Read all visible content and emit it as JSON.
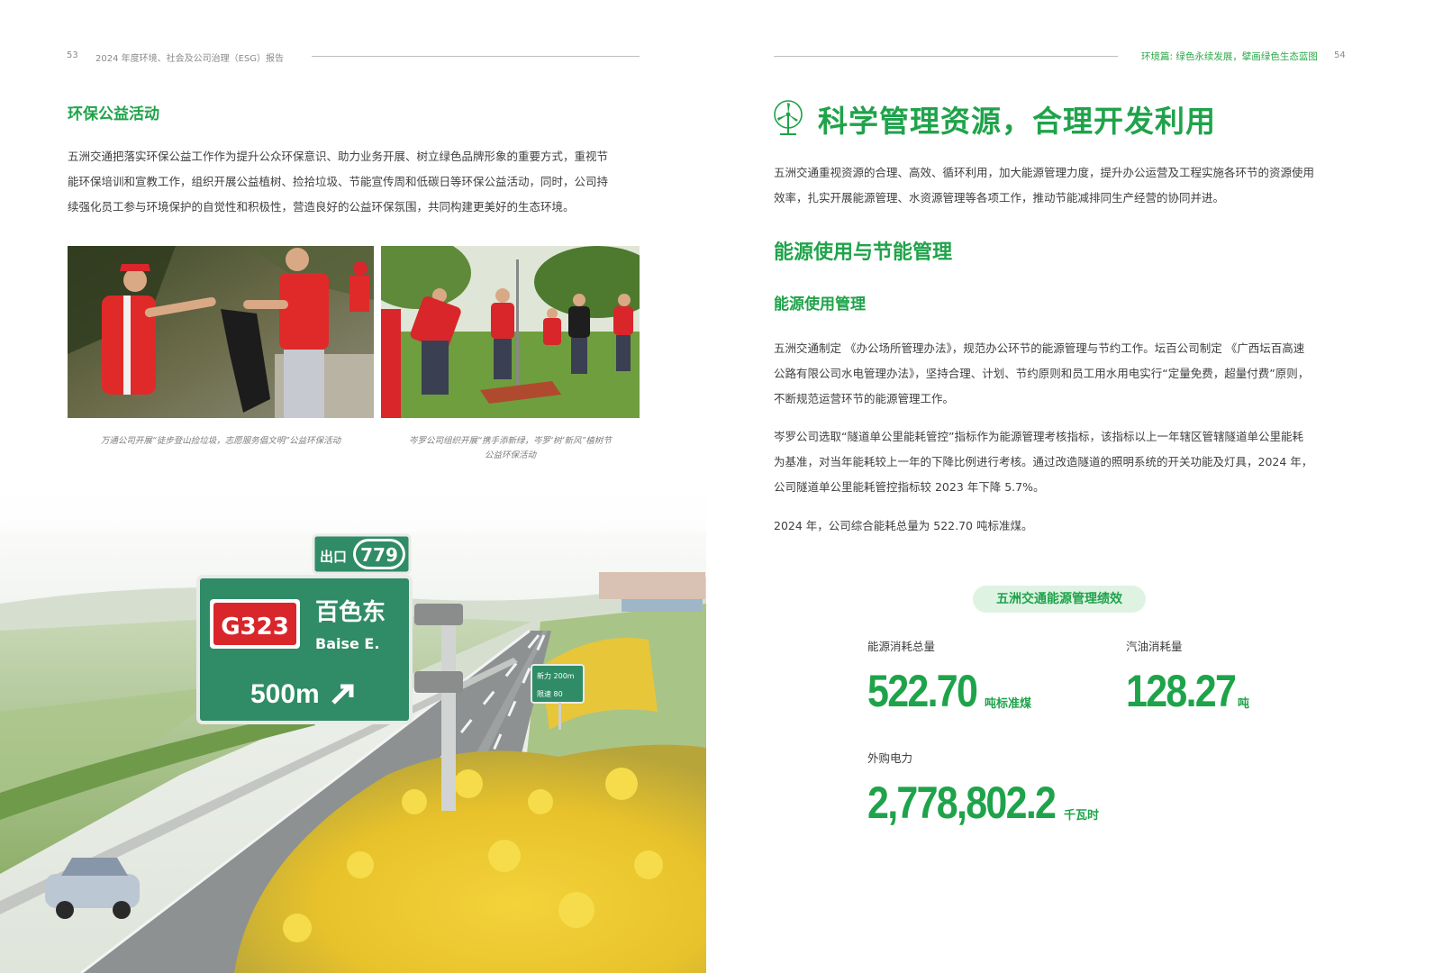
{
  "left_page": {
    "page_number": "53",
    "report_title": "2024 年度环境、社会及公司治理（ESG）报告",
    "section_title": "环保公益活动",
    "paragraph": "五洲交通把落实环保公益工作作为提升公众环保意识、助力业务开展、树立绿色品牌形象的重要方式，重视节能环保培训和宣教工作，组织开展公益植树、捡拾垃圾、节能宣传周和低碳日等环保公益活动，同时，公司持续强化员工参与环境保护的自觉性和积极性，营造良好的公益环保氛围，共同构建更美好的生态环境。",
    "paragraph_lines": [
      "五洲交通把落实环保公益工作作为提升公众环保意识、助力业务开展、树立绿色品牌形象的重要方式，重视节",
      "能环保培训和宣教工作，组织开展公益植树、捡拾垃圾、节能宣传周和低碳日等环保公益活动，同时，公司持",
      "续强化员工参与环境保护的自觉性和积极性，营造良好的公益环保氛围，共同构建更美好的生态环境。"
    ],
    "caption_1": "万通公司开展“徒步登山捡垃圾，志愿服务倡文明”公益环保活动",
    "caption_2_line1": "岑罗公司组织开展“携手添新绿，岑罗‘树’新风”植树节",
    "caption_2_line2": "公益环保活动",
    "road_sign": {
      "exit_label": "出口",
      "exit_number": "779",
      "route": "G323",
      "destination_cn": "百色东",
      "destination_en": "Baise E.",
      "distance": "500m",
      "small_sign_1": "新力 200m",
      "small_sign_2": "限速 80"
    }
  },
  "right_page": {
    "page_number": "54",
    "chapter_title": "环境篇: 绿色永续发展，擘画绿色生态蓝图",
    "main_title": "科学管理资源，合理开发利用",
    "intro_lines": [
      "五洲交通重视资源的合理、高效、循环利用，加大能源管理力度，提升办公运营及工程实施各环节的资源使用",
      "效率，扎实开展能源管理、水资源管理等各项工作，推动节能减排同生产经营的协同并进。"
    ],
    "h2": "能源使用与节能管理",
    "h3": "能源使用管理",
    "para1_lines": [
      "五洲交通制定 《办公场所管理办法》，规范办公环节的能源管理与节约工作。坛百公司制定 《广西坛百高速",
      "公路有限公司水电管理办法》，坚持合理、计划、节约原则和员工用水用电实行“定量免费，超量付费”原则，",
      "不断规范运营环节的能源管理工作。"
    ],
    "para2_lines": [
      "岑罗公司选取“隧道单公里能耗管控”指标作为能源管理考核指标，该指标以上一年辖区管辖隧道单公里能耗",
      "为基准，对当年能耗较上一年的下降比例进行考核。通过改造隧道的照明系统的开关功能及灯具，2024 年，",
      "公司隧道单公里能耗管控指标较 2023 年下降 5.7%。"
    ],
    "para3": "2024 年，公司综合能耗总量为 522.70 吨标准煤。",
    "performance_title": "五洲交通能源管理绩效",
    "stats": {
      "energy_label": "能源消耗总量",
      "energy_value": "522.70",
      "energy_unit": "吨标准煤",
      "gasoline_label": "汽油消耗量",
      "gasoline_value": "128.27",
      "gasoline_unit": "吨",
      "electricity_label": "外购电力",
      "electricity_value": "2,778,802.2",
      "electricity_unit": "千瓦时"
    },
    "colors": {
      "accent": "#1fa34a",
      "pill_bg": "#dff3e3"
    }
  }
}
